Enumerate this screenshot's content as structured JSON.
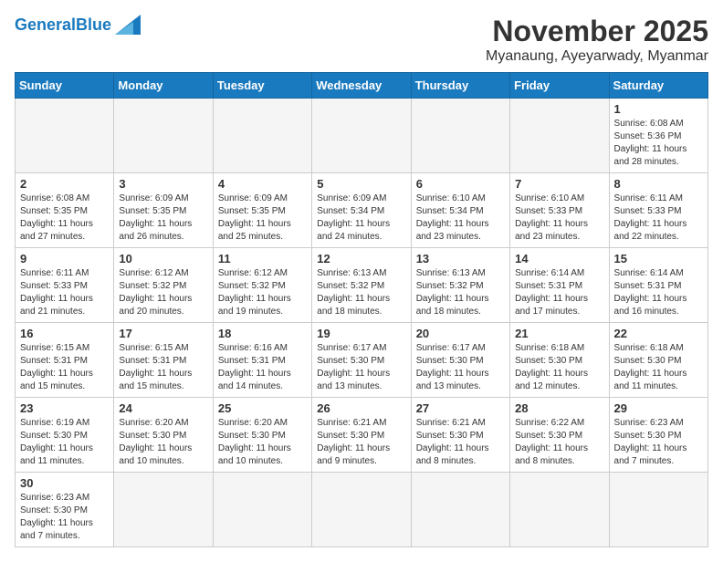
{
  "header": {
    "logo_general": "General",
    "logo_blue": "Blue",
    "month_title": "November 2025",
    "location": "Myanaung, Ayeyarwady, Myanmar"
  },
  "weekdays": [
    "Sunday",
    "Monday",
    "Tuesday",
    "Wednesday",
    "Thursday",
    "Friday",
    "Saturday"
  ],
  "weeks": [
    [
      {
        "day": "",
        "empty": true,
        "lines": []
      },
      {
        "day": "",
        "empty": true,
        "lines": []
      },
      {
        "day": "",
        "empty": true,
        "lines": []
      },
      {
        "day": "",
        "empty": true,
        "lines": []
      },
      {
        "day": "",
        "empty": true,
        "lines": []
      },
      {
        "day": "",
        "empty": true,
        "lines": []
      },
      {
        "day": "1",
        "empty": false,
        "lines": [
          "Sunrise: 6:08 AM",
          "Sunset: 5:36 PM",
          "Daylight: 11 hours",
          "and 28 minutes."
        ]
      }
    ],
    [
      {
        "day": "2",
        "empty": false,
        "lines": [
          "Sunrise: 6:08 AM",
          "Sunset: 5:35 PM",
          "Daylight: 11 hours",
          "and 27 minutes."
        ]
      },
      {
        "day": "3",
        "empty": false,
        "lines": [
          "Sunrise: 6:09 AM",
          "Sunset: 5:35 PM",
          "Daylight: 11 hours",
          "and 26 minutes."
        ]
      },
      {
        "day": "4",
        "empty": false,
        "lines": [
          "Sunrise: 6:09 AM",
          "Sunset: 5:35 PM",
          "Daylight: 11 hours",
          "and 25 minutes."
        ]
      },
      {
        "day": "5",
        "empty": false,
        "lines": [
          "Sunrise: 6:09 AM",
          "Sunset: 5:34 PM",
          "Daylight: 11 hours",
          "and 24 minutes."
        ]
      },
      {
        "day": "6",
        "empty": false,
        "lines": [
          "Sunrise: 6:10 AM",
          "Sunset: 5:34 PM",
          "Daylight: 11 hours",
          "and 23 minutes."
        ]
      },
      {
        "day": "7",
        "empty": false,
        "lines": [
          "Sunrise: 6:10 AM",
          "Sunset: 5:33 PM",
          "Daylight: 11 hours",
          "and 23 minutes."
        ]
      },
      {
        "day": "8",
        "empty": false,
        "lines": [
          "Sunrise: 6:11 AM",
          "Sunset: 5:33 PM",
          "Daylight: 11 hours",
          "and 22 minutes."
        ]
      }
    ],
    [
      {
        "day": "9",
        "empty": false,
        "lines": [
          "Sunrise: 6:11 AM",
          "Sunset: 5:33 PM",
          "Daylight: 11 hours",
          "and 21 minutes."
        ]
      },
      {
        "day": "10",
        "empty": false,
        "lines": [
          "Sunrise: 6:12 AM",
          "Sunset: 5:32 PM",
          "Daylight: 11 hours",
          "and 20 minutes."
        ]
      },
      {
        "day": "11",
        "empty": false,
        "lines": [
          "Sunrise: 6:12 AM",
          "Sunset: 5:32 PM",
          "Daylight: 11 hours",
          "and 19 minutes."
        ]
      },
      {
        "day": "12",
        "empty": false,
        "lines": [
          "Sunrise: 6:13 AM",
          "Sunset: 5:32 PM",
          "Daylight: 11 hours",
          "and 18 minutes."
        ]
      },
      {
        "day": "13",
        "empty": false,
        "lines": [
          "Sunrise: 6:13 AM",
          "Sunset: 5:32 PM",
          "Daylight: 11 hours",
          "and 18 minutes."
        ]
      },
      {
        "day": "14",
        "empty": false,
        "lines": [
          "Sunrise: 6:14 AM",
          "Sunset: 5:31 PM",
          "Daylight: 11 hours",
          "and 17 minutes."
        ]
      },
      {
        "day": "15",
        "empty": false,
        "lines": [
          "Sunrise: 6:14 AM",
          "Sunset: 5:31 PM",
          "Daylight: 11 hours",
          "and 16 minutes."
        ]
      }
    ],
    [
      {
        "day": "16",
        "empty": false,
        "lines": [
          "Sunrise: 6:15 AM",
          "Sunset: 5:31 PM",
          "Daylight: 11 hours",
          "and 15 minutes."
        ]
      },
      {
        "day": "17",
        "empty": false,
        "lines": [
          "Sunrise: 6:15 AM",
          "Sunset: 5:31 PM",
          "Daylight: 11 hours",
          "and 15 minutes."
        ]
      },
      {
        "day": "18",
        "empty": false,
        "lines": [
          "Sunrise: 6:16 AM",
          "Sunset: 5:31 PM",
          "Daylight: 11 hours",
          "and 14 minutes."
        ]
      },
      {
        "day": "19",
        "empty": false,
        "lines": [
          "Sunrise: 6:17 AM",
          "Sunset: 5:30 PM",
          "Daylight: 11 hours",
          "and 13 minutes."
        ]
      },
      {
        "day": "20",
        "empty": false,
        "lines": [
          "Sunrise: 6:17 AM",
          "Sunset: 5:30 PM",
          "Daylight: 11 hours",
          "and 13 minutes."
        ]
      },
      {
        "day": "21",
        "empty": false,
        "lines": [
          "Sunrise: 6:18 AM",
          "Sunset: 5:30 PM",
          "Daylight: 11 hours",
          "and 12 minutes."
        ]
      },
      {
        "day": "22",
        "empty": false,
        "lines": [
          "Sunrise: 6:18 AM",
          "Sunset: 5:30 PM",
          "Daylight: 11 hours",
          "and 11 minutes."
        ]
      }
    ],
    [
      {
        "day": "23",
        "empty": false,
        "lines": [
          "Sunrise: 6:19 AM",
          "Sunset: 5:30 PM",
          "Daylight: 11 hours",
          "and 11 minutes."
        ]
      },
      {
        "day": "24",
        "empty": false,
        "lines": [
          "Sunrise: 6:20 AM",
          "Sunset: 5:30 PM",
          "Daylight: 11 hours",
          "and 10 minutes."
        ]
      },
      {
        "day": "25",
        "empty": false,
        "lines": [
          "Sunrise: 6:20 AM",
          "Sunset: 5:30 PM",
          "Daylight: 11 hours",
          "and 10 minutes."
        ]
      },
      {
        "day": "26",
        "empty": false,
        "lines": [
          "Sunrise: 6:21 AM",
          "Sunset: 5:30 PM",
          "Daylight: 11 hours",
          "and 9 minutes."
        ]
      },
      {
        "day": "27",
        "empty": false,
        "lines": [
          "Sunrise: 6:21 AM",
          "Sunset: 5:30 PM",
          "Daylight: 11 hours",
          "and 8 minutes."
        ]
      },
      {
        "day": "28",
        "empty": false,
        "lines": [
          "Sunrise: 6:22 AM",
          "Sunset: 5:30 PM",
          "Daylight: 11 hours",
          "and 8 minutes."
        ]
      },
      {
        "day": "29",
        "empty": false,
        "lines": [
          "Sunrise: 6:23 AM",
          "Sunset: 5:30 PM",
          "Daylight: 11 hours",
          "and 7 minutes."
        ]
      }
    ],
    [
      {
        "day": "30",
        "empty": false,
        "lines": [
          "Sunrise: 6:23 AM",
          "Sunset: 5:30 PM",
          "Daylight: 11 hours",
          "and 7 minutes."
        ]
      },
      {
        "day": "",
        "empty": true,
        "lines": []
      },
      {
        "day": "",
        "empty": true,
        "lines": []
      },
      {
        "day": "",
        "empty": true,
        "lines": []
      },
      {
        "day": "",
        "empty": true,
        "lines": []
      },
      {
        "day": "",
        "empty": true,
        "lines": []
      },
      {
        "day": "",
        "empty": true,
        "lines": []
      }
    ]
  ]
}
